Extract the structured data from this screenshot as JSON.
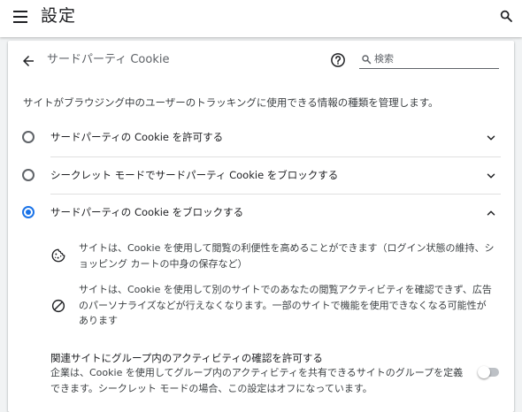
{
  "header": {
    "menu_icon": "hamburger-menu-icon",
    "title": "設定",
    "search_icon": "search-icon"
  },
  "page": {
    "back_icon": "arrow-back-icon",
    "title": "サードパーティ Cookie",
    "help_icon": "help-circle-icon",
    "search_placeholder": "検索",
    "description": "サイトがブラウジング中のユーザーのトラッキングに使用できる情報の種類を管理します。"
  },
  "options": [
    {
      "label": "サードパーティの Cookie を許可する",
      "checked": false,
      "expanded": false
    },
    {
      "label": "シークレット モードでサードパーティ Cookie をブロックする",
      "checked": false,
      "expanded": false
    },
    {
      "label": "サードパーティの Cookie をブロックする",
      "checked": true,
      "expanded": true
    }
  ],
  "details": [
    {
      "icon": "cookie-icon",
      "text": "サイトは、Cookie を使用して閲覧の利便性を高めることができます（ログイン状態の維持、ショッピング カートの中身の保存など）"
    },
    {
      "icon": "block-icon",
      "text": "サイトは、Cookie を使用して別のサイトでのあなたの閲覧アクティビティを確認できず、広告のパーソナライズなどが行えなくなります。一部のサイトで機能を使用できなくなる可能性があります"
    }
  ],
  "related_sites": {
    "title": "関連サイトにグループ内のアクティビティの確認を許可する",
    "description": "企業は、Cookie を使用してグループ内のアクティビティを共有できるサイトのグループを定義できます。シークレット モードの場合、この設定はオフになっています。",
    "toggle_on": false
  },
  "colors": {
    "accent": "#1a73e8",
    "background": "#f1f3f4",
    "card": "#ffffff",
    "text": "#202124",
    "secondary_text": "#5f6368"
  }
}
